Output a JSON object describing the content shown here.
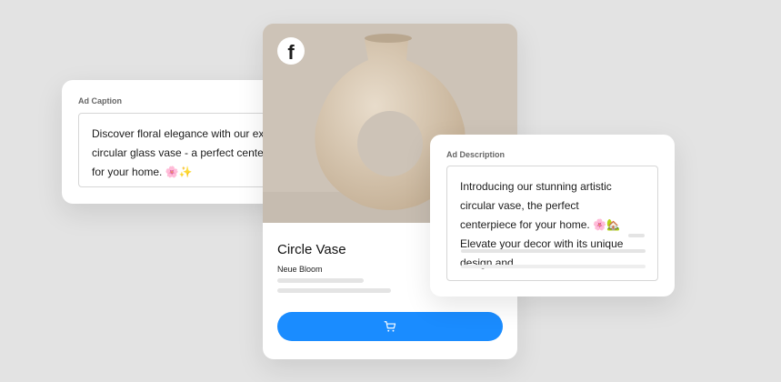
{
  "caption": {
    "label": "Ad Caption",
    "text": "Discover floral elegance with our exquisite circular glass vase - a perfect centerpiece for your home. 🌸✨"
  },
  "product": {
    "title": "Circle Vase",
    "brand": "Neue Bloom",
    "social_icon": "facebook-icon",
    "cart_icon": "cart-icon",
    "button_color": "#1a8cff"
  },
  "description": {
    "label": "Ad Description",
    "text": "Introducing our stunning artistic circular vase, the perfect centerpiece for your home. 🌸🏡 Elevate your decor with its unique design and"
  }
}
